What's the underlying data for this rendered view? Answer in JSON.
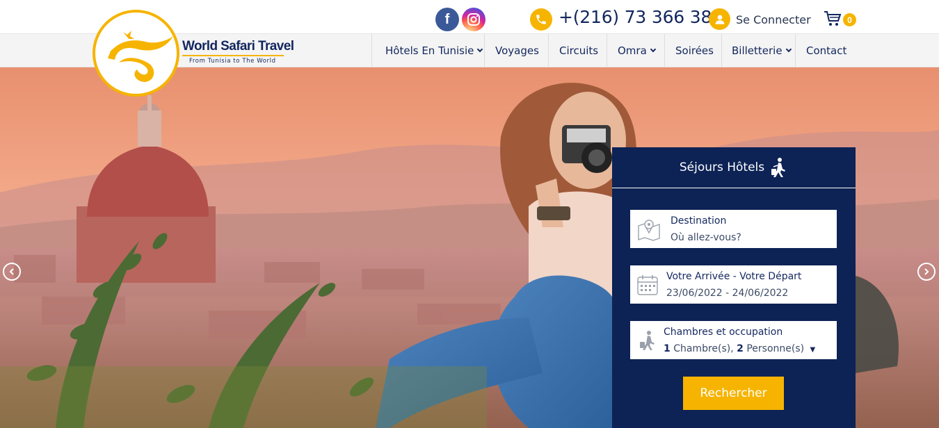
{
  "header": {
    "phone": "+(216) 73 366 383",
    "login_label": "Se Connecter",
    "cart_count": "0",
    "social": [
      "facebook-icon",
      "instagram-icon"
    ]
  },
  "brand": {
    "name": "World Safari Travel",
    "tagline": "From Tunisia to The World"
  },
  "nav": {
    "items": [
      {
        "label": "Hôtels En Tunisie",
        "dropdown": true
      },
      {
        "label": "Voyages",
        "dropdown": false
      },
      {
        "label": "Circuits",
        "dropdown": false
      },
      {
        "label": "Omra",
        "dropdown": true
      },
      {
        "label": "Soirées",
        "dropdown": false
      },
      {
        "label": "Billetterie",
        "dropdown": true
      },
      {
        "label": "Contact",
        "dropdown": false
      }
    ]
  },
  "search": {
    "title": "Séjours Hôtels",
    "destination_label": "Destination",
    "destination_placeholder": "Où allez-vous?",
    "dates_label": "Votre Arrivée - Votre Départ",
    "dates_value": "23/06/2022 - 24/06/2022",
    "occupancy_label": "Chambres et occupation",
    "rooms_count": "1",
    "rooms_unit": "Chambre(s),",
    "persons_count": "2",
    "persons_unit": "Personne(s)",
    "submit_label": "Rechercher"
  },
  "colors": {
    "accent": "#f6b400",
    "navy": "#0d2255",
    "text": "#13275e"
  }
}
